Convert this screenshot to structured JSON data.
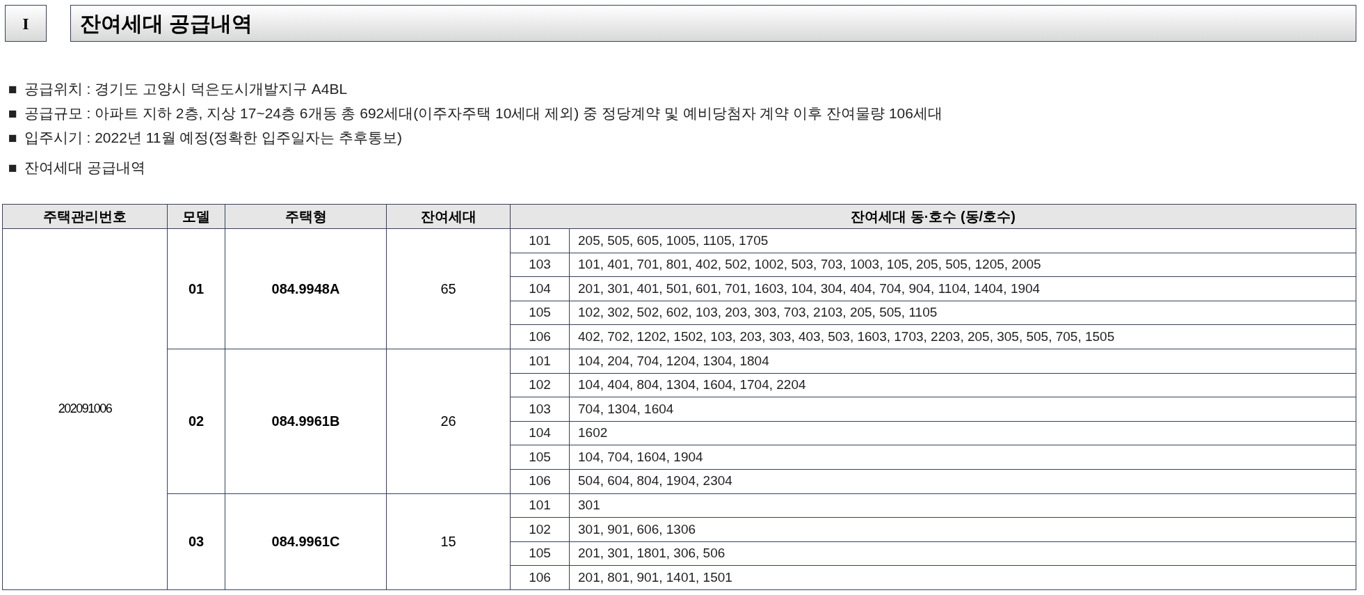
{
  "section": {
    "number": "I",
    "title": "잔여세대 공급내역"
  },
  "bullets": [
    {
      "marker": "■",
      "text": "공급위치 : 경기도 고양시 덕은도시개발지구 A4BL"
    },
    {
      "marker": "■",
      "text": "공급규모 : 아파트 지하 2층, 지상 17~24층 6개동 총 692세대(이주자주택 10세대 제외) 중 정당계약 및 예비당첨자 계약 이후 잔여물량 106세대"
    },
    {
      "marker": "■",
      "text": "입주시기 : 2022년 11월 예정(정확한 입주일자는 추후통보)"
    },
    {
      "marker": "■",
      "text": "잔여세대 공급내역"
    }
  ],
  "table": {
    "columns": [
      "주택관리번호",
      "모델",
      "주택형",
      "잔여세대",
      "잔여세대 동·호수 (동/호수)"
    ],
    "management_number": "202091006",
    "models": [
      {
        "model": "01",
        "type": "084.9948A",
        "remaining": "65",
        "buildings": [
          {
            "dong": "101",
            "units": "205, 505, 605, 1005, 1105, 1705"
          },
          {
            "dong": "103",
            "units": "101, 401, 701, 801, 402, 502, 1002, 503, 703, 1003, 105, 205, 505, 1205, 2005"
          },
          {
            "dong": "104",
            "units": "201, 301, 401, 501, 601, 701, 1603, 104, 304, 404, 704, 904, 1104, 1404, 1904"
          },
          {
            "dong": "105",
            "units": "102, 302, 502, 602, 103, 203, 303, 703, 2103, 205, 505, 1105"
          },
          {
            "dong": "106",
            "units": "402, 702, 1202, 1502, 103, 203, 303, 403, 503, 1603, 1703, 2203, 205, 305, 505, 705, 1505"
          }
        ]
      },
      {
        "model": "02",
        "type": "084.9961B",
        "remaining": "26",
        "buildings": [
          {
            "dong": "101",
            "units": "104, 204, 704, 1204, 1304, 1804"
          },
          {
            "dong": "102",
            "units": "104, 404, 804, 1304, 1604, 1704, 2204"
          },
          {
            "dong": "103",
            "units": "704, 1304, 1604"
          },
          {
            "dong": "104",
            "units": "1602"
          },
          {
            "dong": "105",
            "units": "104, 704, 1604, 1904"
          },
          {
            "dong": "106",
            "units": "504, 604, 804, 1904, 2304"
          }
        ]
      },
      {
        "model": "03",
        "type": "084.9961C",
        "remaining": "15",
        "buildings": [
          {
            "dong": "101",
            "units": "301"
          },
          {
            "dong": "102",
            "units": "301, 901, 606, 1306"
          },
          {
            "dong": "105",
            "units": "201, 301, 1801, 306, 506"
          },
          {
            "dong": "106",
            "units": "201, 801, 901, 1401, 1501"
          }
        ]
      }
    ]
  }
}
